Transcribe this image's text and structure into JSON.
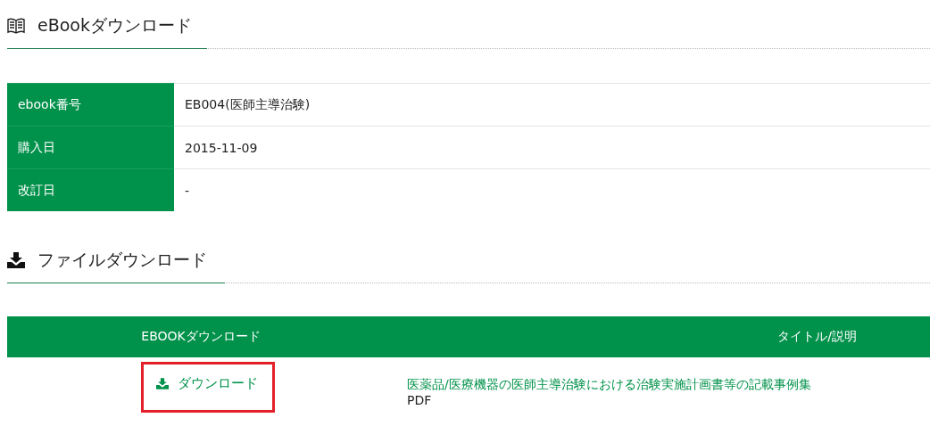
{
  "ebook_section": {
    "title": "eBookダウンロード"
  },
  "info_table": {
    "rows": [
      {
        "label": "ebook番号",
        "value": "EB004(医師主導治験)"
      },
      {
        "label": "購入日",
        "value": "2015-11-09"
      },
      {
        "label": "改訂日",
        "value": "-"
      }
    ]
  },
  "file_section": {
    "title": "ファイルダウンロード"
  },
  "download_table": {
    "columns": [
      "EBOOKダウンロード",
      "タイトル/説明"
    ],
    "rows": [
      {
        "link": {
          "label": "ダウンロード",
          "highlighted": true
        },
        "title": "医薬品/医療機器の医師主導治験における治験実施計画書等の記載事例集",
        "format": "PDF"
      }
    ]
  }
}
